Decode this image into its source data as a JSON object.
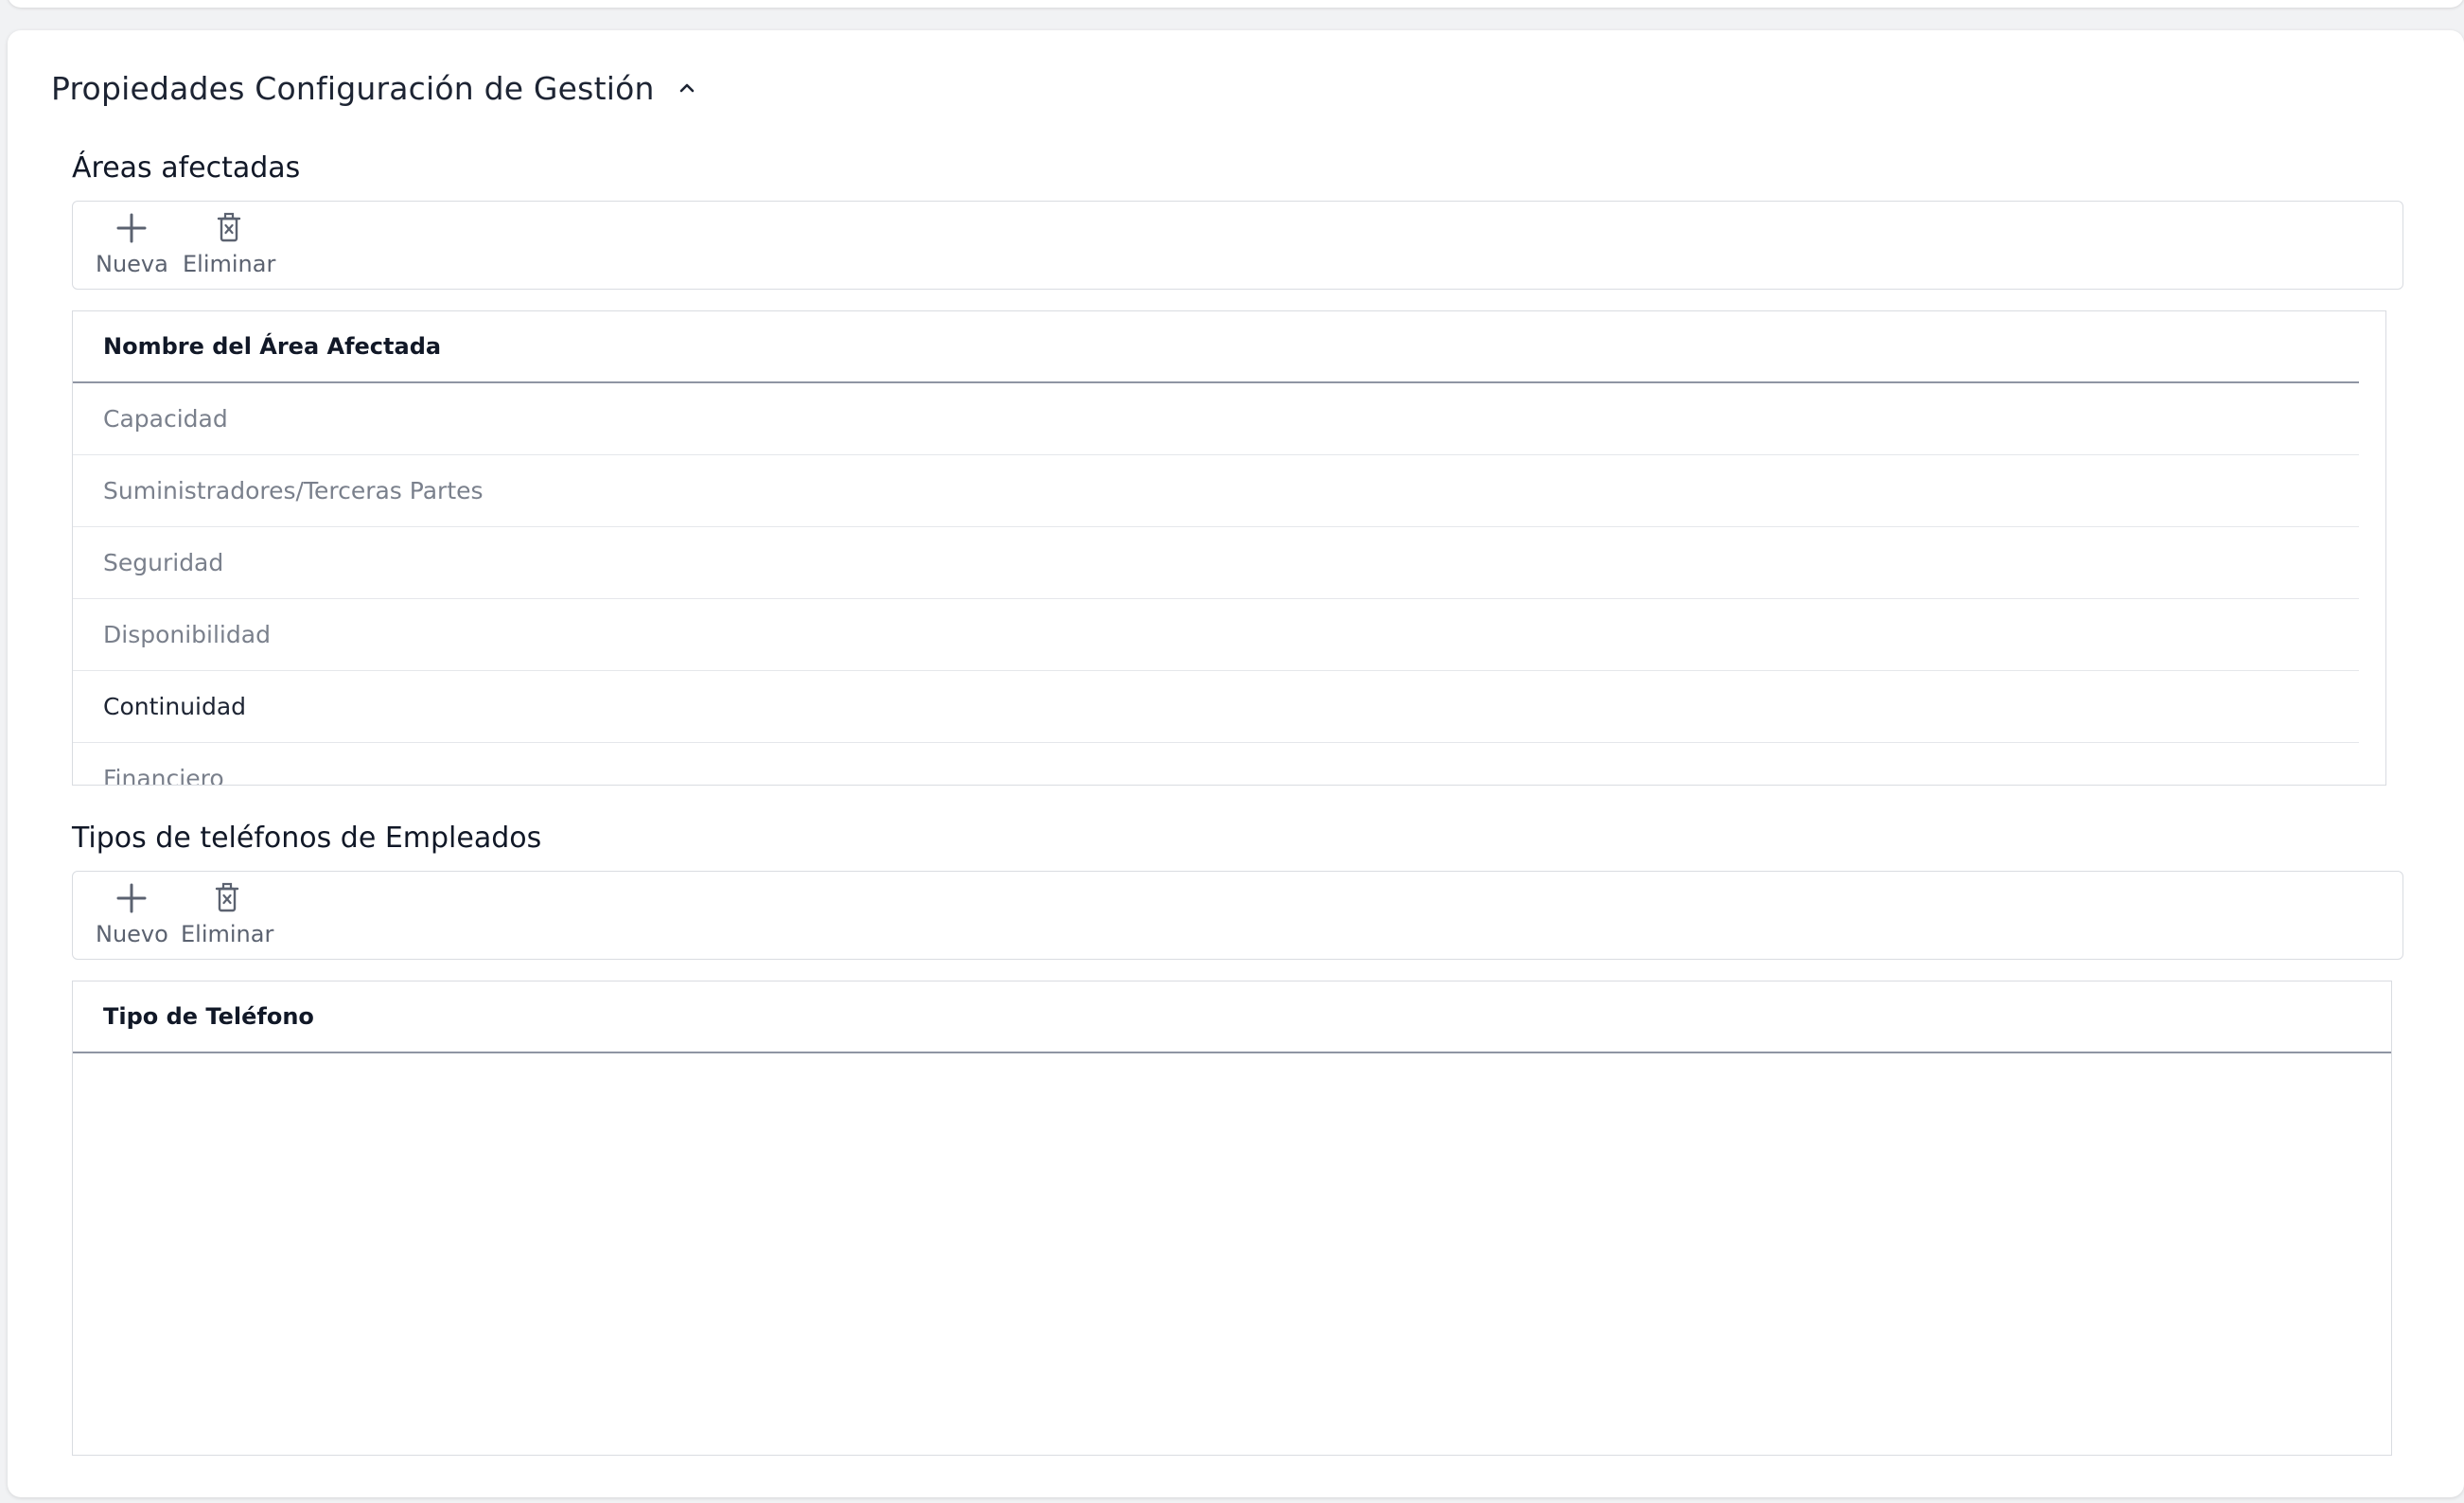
{
  "panel": {
    "title": "Propiedades Configuración de Gestión"
  },
  "areas": {
    "title": "Áreas afectadas",
    "toolbar": {
      "new_label": "Nueva",
      "delete_label": "Eliminar"
    },
    "column_header": "Nombre del Área Afectada",
    "rows": [
      "Capacidad",
      "Suministradores/Terceras Partes",
      "Seguridad",
      "Disponibilidad",
      "Continuidad",
      "Financiero"
    ]
  },
  "phones": {
    "title": "Tipos de teléfonos de Empleados",
    "toolbar": {
      "new_label": "Nuevo",
      "delete_label": "Eliminar"
    },
    "column_header": "Tipo de Teléfono",
    "rows": []
  },
  "colors": {
    "text_primary": "#1d2433",
    "text_muted": "#7a808c",
    "border": "#d9dce1",
    "icon": "#5b6270"
  }
}
